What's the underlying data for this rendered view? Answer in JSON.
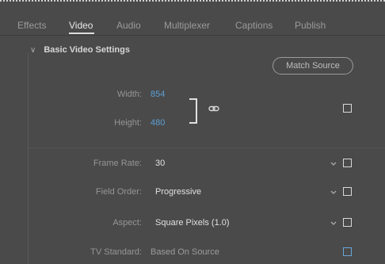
{
  "tabs": [
    {
      "label": "Effects",
      "active": false
    },
    {
      "label": "Video",
      "active": true
    },
    {
      "label": "Audio",
      "active": false
    },
    {
      "label": "Multiplexer",
      "active": false
    },
    {
      "label": "Captions",
      "active": false
    },
    {
      "label": "Publish",
      "active": false
    }
  ],
  "section": {
    "title": "Basic Video Settings",
    "expanded": true
  },
  "match_source_label": "Match Source",
  "dimensions": {
    "width_label": "Width:",
    "width_value": "854",
    "height_label": "Height:",
    "height_value": "480",
    "linked": true
  },
  "frame_rate": {
    "label": "Frame Rate:",
    "value": "30"
  },
  "field_order": {
    "label": "Field Order:",
    "value": "Progressive"
  },
  "aspect": {
    "label": "Aspect:",
    "value": "Square Pixels (1.0)"
  },
  "tv_standard": {
    "label": "TV Standard:",
    "value": "Based On Source"
  },
  "colors": {
    "accent": "#5b9fd3",
    "background": "#4a4a4a"
  }
}
